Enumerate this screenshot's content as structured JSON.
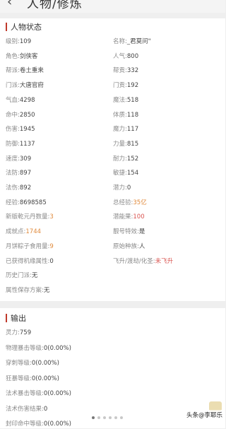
{
  "header": {
    "back_icon": "‹",
    "title": "人物/修炼",
    "chevron": "˅"
  },
  "status": {
    "title": "人物状态",
    "rows": [
      {
        "l_label": "级别:",
        "l_value": "109",
        "r_label": "名称:",
        "r_value": "_君莫问\"",
        "r_color": ""
      },
      {
        "l_label": "角色:",
        "l_value": "剑侠客",
        "r_label": "人气:",
        "r_value": "800",
        "r_color": ""
      },
      {
        "l_label": "帮派:",
        "l_value": "卷土重来",
        "r_label": "帮贡:",
        "r_value": "332",
        "r_color": ""
      },
      {
        "l_label": "门派:",
        "l_value": "大唐官府",
        "r_label": "门贡:",
        "r_value": "192",
        "r_color": ""
      },
      {
        "l_label": "气血:",
        "l_value": "4298",
        "r_label": "魔法:",
        "r_value": "518",
        "r_color": ""
      },
      {
        "l_label": "命中:",
        "l_value": "2850",
        "r_label": "体质:",
        "r_value": "118",
        "r_color": ""
      },
      {
        "l_label": "伤害:",
        "l_value": "1945",
        "r_label": "魔力:",
        "r_value": "117",
        "r_color": ""
      },
      {
        "l_label": "防御:",
        "l_value": "1137",
        "r_label": "力量:",
        "r_value": "815",
        "r_color": ""
      },
      {
        "l_label": "速度:",
        "l_value": "309",
        "r_label": "耐力:",
        "r_value": "152",
        "r_color": ""
      },
      {
        "l_label": "法防:",
        "l_value": "897",
        "r_label": "敏捷:",
        "r_value": "154",
        "r_color": ""
      },
      {
        "l_label": "法伤:",
        "l_value": "892",
        "r_label": "潜力:",
        "r_value": "0",
        "r_color": ""
      },
      {
        "l_label": "经验:",
        "l_value": "8698585",
        "r_label": "总经验:",
        "r_value": "35亿",
        "r_color": "orange"
      },
      {
        "l_label": "新版乾元丹数量:",
        "l_value": "3",
        "l_color": "orange",
        "r_label": "潜能果:",
        "r_value": "100",
        "r_color": "red"
      },
      {
        "l_label": "成就点:",
        "l_value": "1744",
        "l_color": "orange",
        "r_label": "靓号特效:",
        "r_value": "是",
        "r_color": ""
      },
      {
        "l_label": "月饼粽子食用量:",
        "l_value": "9",
        "l_color": "orange",
        "r_label": "原始种族:",
        "r_value": "人",
        "r_color": ""
      },
      {
        "l_label": "已获得机缘属性:",
        "l_value": "0",
        "r_label": "飞升/渡劫/化圣:",
        "r_value": "未飞升",
        "r_color": "red"
      },
      {
        "l_label": "历史门派:",
        "l_value": "无",
        "r_label": "",
        "r_value": ""
      },
      {
        "l_label": "属性保存方案:",
        "l_value": "无",
        "r_label": "",
        "r_value": ""
      }
    ]
  },
  "output": {
    "title": "输出",
    "rows": [
      {
        "label": "灵力:",
        "value": "759"
      },
      {
        "label": "物理暴击等级:",
        "value": "0(0.00%)"
      },
      {
        "label": "穿刺等级:",
        "value": "0(0.00%)"
      },
      {
        "label": "狂暴等级:",
        "value": "0(0.00%)"
      },
      {
        "label": "法术暴击等级:",
        "value": "0(0.00%)"
      },
      {
        "label": "法术伤害结果:",
        "value": "0"
      },
      {
        "label": "封印命中等级:",
        "value": "0(0.00%)"
      }
    ]
  },
  "pager": {
    "count": 6,
    "active": 0
  },
  "watermark": "头条@李耶乐"
}
